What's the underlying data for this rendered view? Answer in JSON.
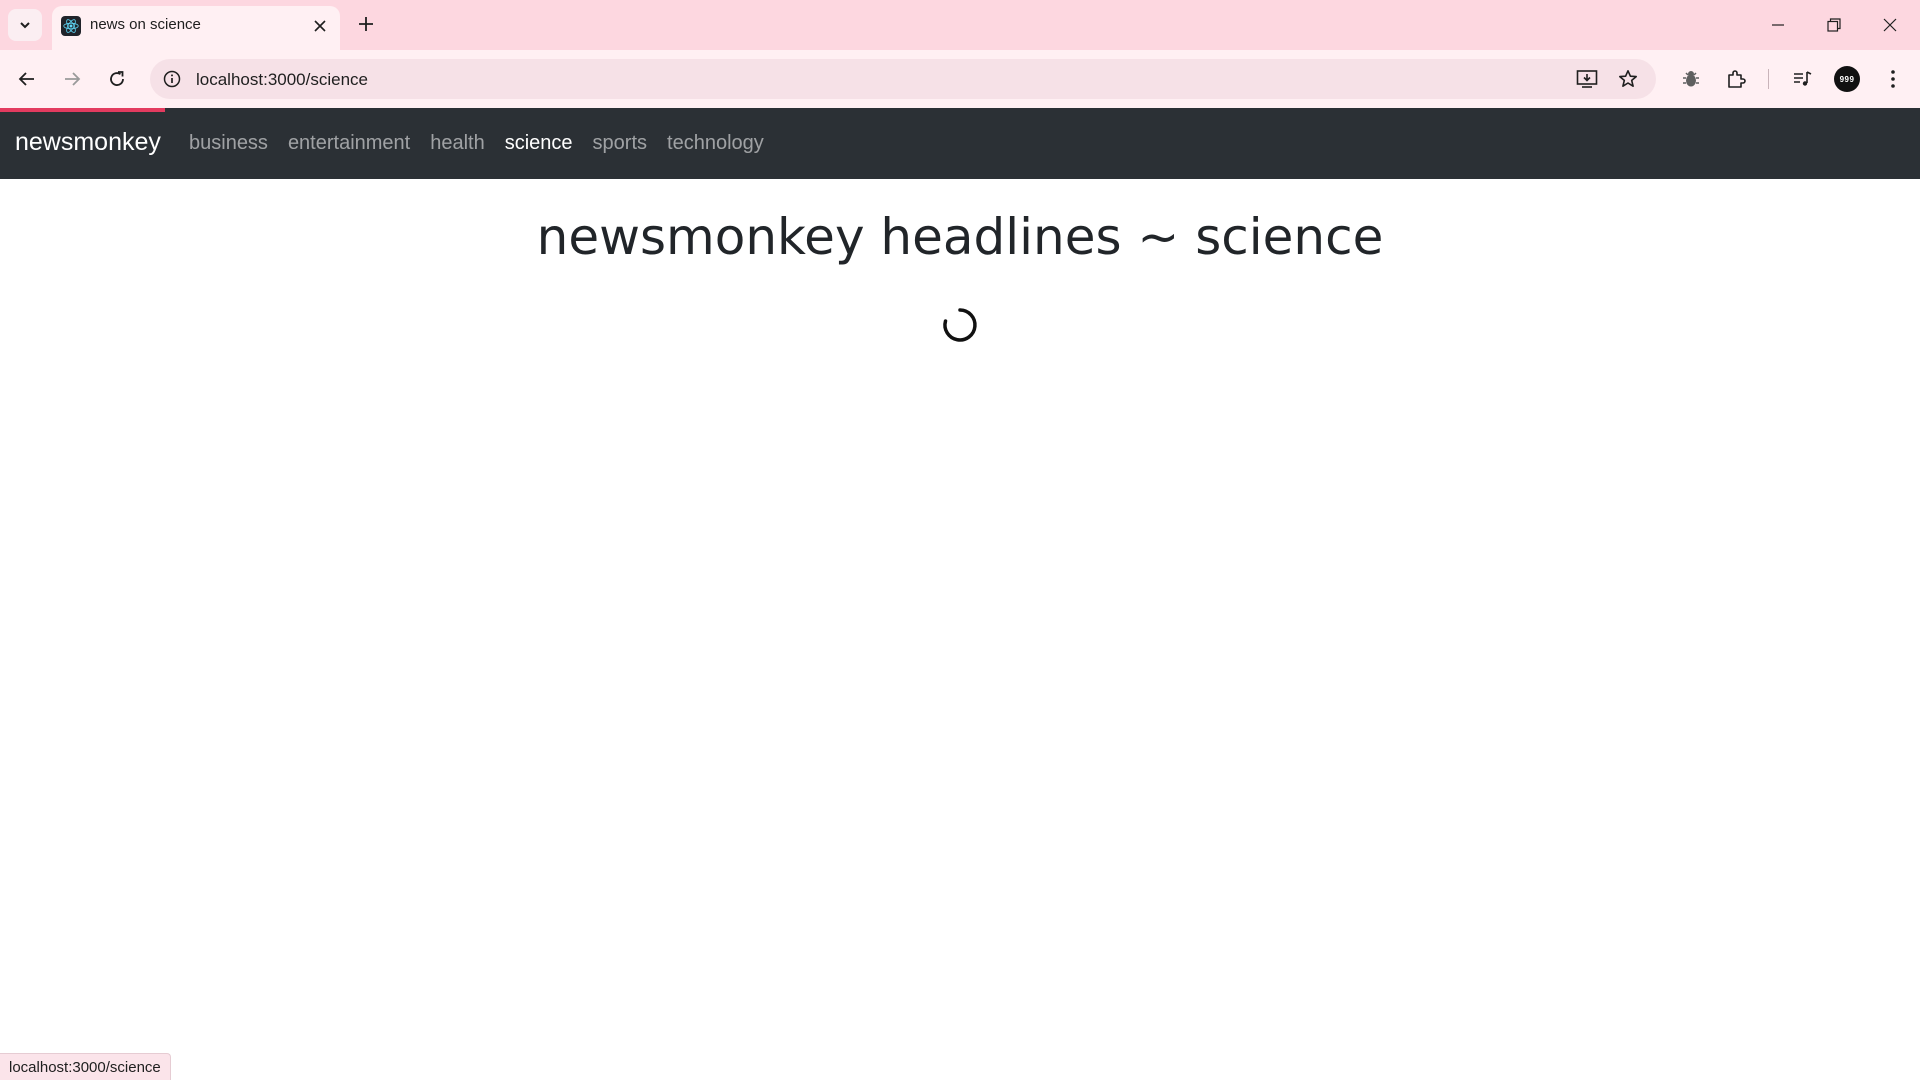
{
  "browser": {
    "tab_title": "news on science",
    "url": "localhost:3000/science",
    "avatar_text": "999"
  },
  "app": {
    "brand": "newsmonkey",
    "nav": [
      {
        "label": "business",
        "active": false
      },
      {
        "label": "entertainment",
        "active": false
      },
      {
        "label": "health",
        "active": false
      },
      {
        "label": "science",
        "active": true
      },
      {
        "label": "sports",
        "active": false
      },
      {
        "label": "technology",
        "active": false
      }
    ],
    "headline": "newsmonkey headlines ~ science"
  },
  "status_url": "localhost:3000/science",
  "colors": {
    "tabstrip": "#fdd7e0",
    "navbar": "#2b3035",
    "loading_bar": "#e33b5f"
  },
  "icons": [
    "tab-search-icon",
    "react-icon",
    "close-icon",
    "plus-icon",
    "minimize-icon",
    "restore-icon",
    "window-close-icon",
    "back-icon",
    "forward-icon",
    "reload-icon",
    "info-icon",
    "install-icon",
    "star-icon",
    "bug-icon",
    "puzzle-icon",
    "media-icon",
    "kebab-menu-icon",
    "spinner-icon"
  ]
}
